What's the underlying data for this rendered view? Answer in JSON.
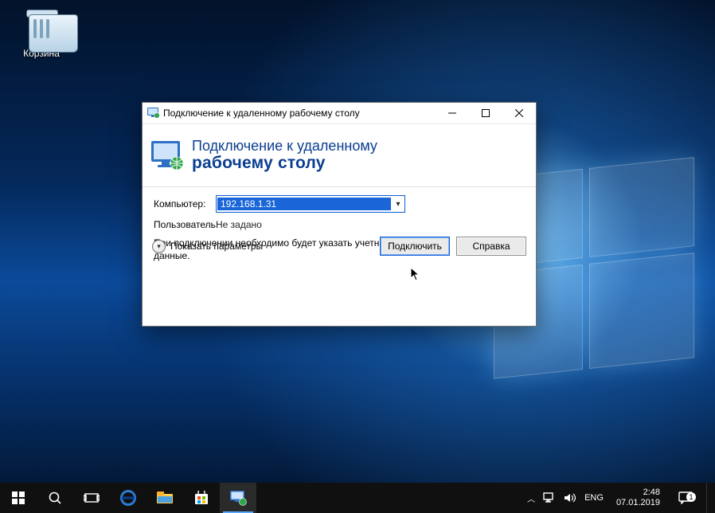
{
  "desktop": {
    "icons": {
      "recycle_bin": "Корзина"
    }
  },
  "window": {
    "title": "Подключение к удаленному рабочему столу",
    "heading_line1": "Подключение к удаленному",
    "heading_line2": "рабочему столу",
    "labels": {
      "computer": "Компьютер:",
      "user": "Пользователь:"
    },
    "values": {
      "computer": "192.168.1.31",
      "user": "Не задано"
    },
    "hint": "При подключении необходимо будет указать учетные данные.",
    "expander": "Показать параметры",
    "buttons": {
      "connect": "Подключить",
      "help": "Справка"
    }
  },
  "taskbar": {
    "tray": {
      "lang": "ENG",
      "time": "2:48",
      "date": "07.01.2019",
      "notifications": "1"
    }
  }
}
